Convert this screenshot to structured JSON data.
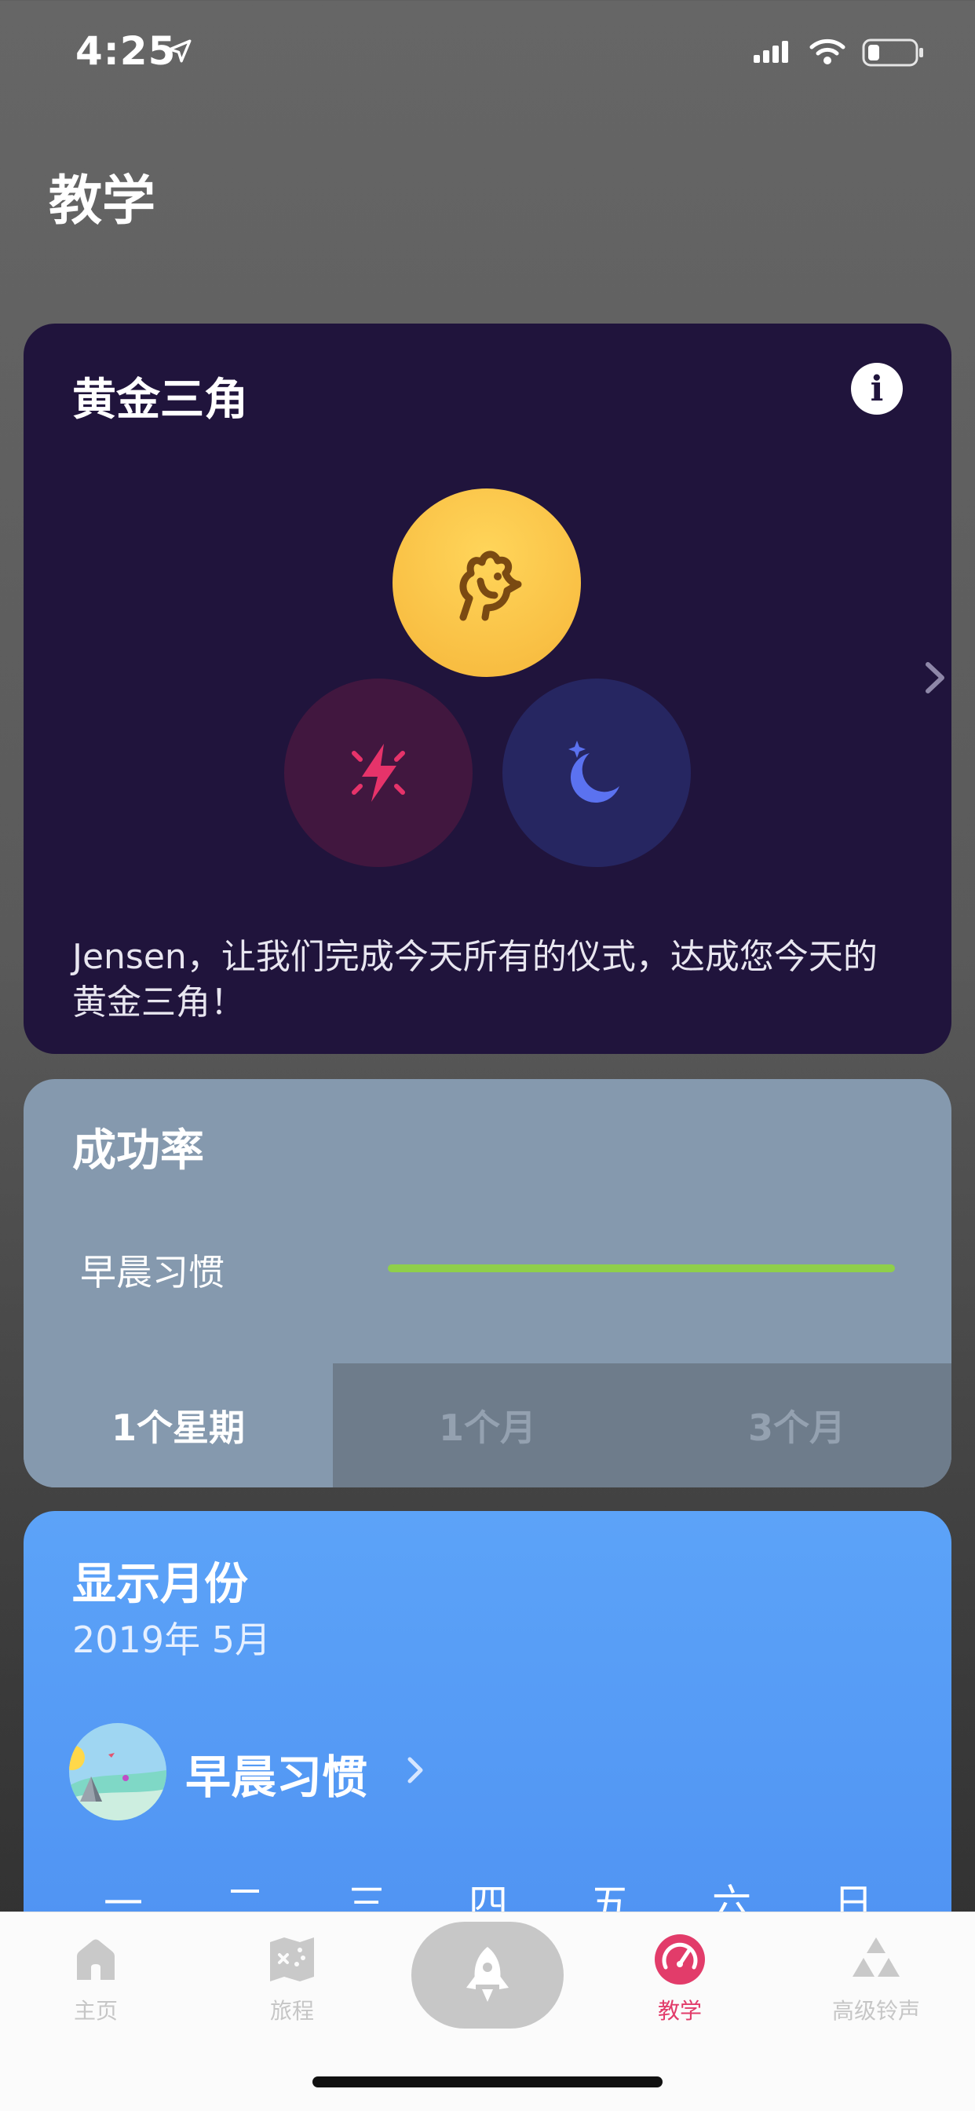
{
  "status_bar": {
    "time": "4:25"
  },
  "page_title": "教学",
  "golden_triangle": {
    "title": "黄金三角",
    "info_label": "i",
    "message": "Jensen，让我们完成今天所有的仪式，达成您今天的黄金三角！",
    "colors": {
      "background": "#20143c",
      "morning": "#f6b63a",
      "energy": "#e6336a",
      "night": "#5b72f0"
    }
  },
  "success_rate": {
    "title": "成功率",
    "habit_label": "早晨习惯",
    "bar_color": "#8fcf4a",
    "segments": [
      {
        "label": "1个星期",
        "active": true
      },
      {
        "label": "1个月",
        "active": false
      },
      {
        "label": "3个月",
        "active": false
      }
    ]
  },
  "show_month": {
    "title": "显示月份",
    "subtitle": "2019年 5月",
    "habit_name": "早晨习惯",
    "weekdays": [
      "一",
      "二",
      "三",
      "四",
      "五",
      "六",
      "日"
    ]
  },
  "tab_bar": {
    "tabs": [
      {
        "label": "主页",
        "icon": "home-icon",
        "active": false
      },
      {
        "label": "旅程",
        "icon": "map-icon",
        "active": false
      },
      {
        "label": "",
        "icon": "rocket-icon",
        "active": false
      },
      {
        "label": "教学",
        "icon": "gauge-icon",
        "active": true
      },
      {
        "label": "高级铃声",
        "icon": "triangle-circles-icon",
        "active": false
      }
    ],
    "active_color": "#e23c6a"
  }
}
